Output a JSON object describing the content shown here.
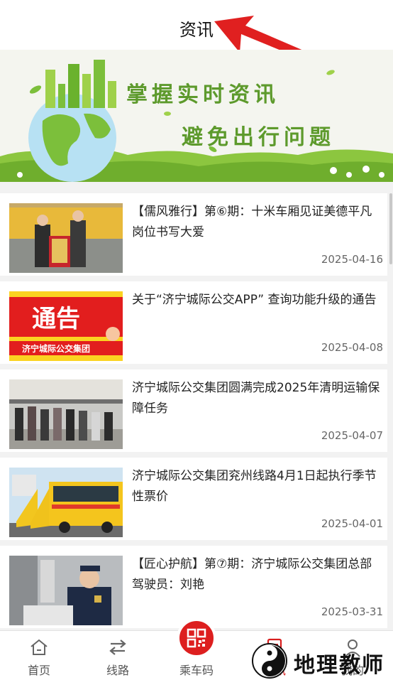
{
  "header": {
    "title": "资讯"
  },
  "banner": {
    "line1": "掌握实时资讯",
    "line2": "避免出行问题"
  },
  "news": [
    {
      "title": "【儒风雅行】第⑥期：十米车厢见证美德平凡岗位书写大爱",
      "date": "2025-04-16",
      "thumb": "photo-staff-with-banner"
    },
    {
      "title": "关于“济宁城际公交APP” 查询功能升级的通告",
      "date": "2025-04-08",
      "thumb": "notice-graphic",
      "thumb_text": "通告",
      "thumb_sub": "济宁城际公交集团"
    },
    {
      "title": "济宁城际公交集团圆满完成2025年清明运输保障任务",
      "date": "2025-04-07",
      "thumb": "photo-station-passengers"
    },
    {
      "title": "济宁城际公交集团兖州线路4月1日起执行季节性票价",
      "date": "2025-04-01",
      "thumb": "photo-yellow-buses"
    },
    {
      "title": "【匠心护航】第⑦期：济宁城际公交集团总部驾驶员：刘艳",
      "date": "2025-03-31",
      "thumb": "photo-driver"
    }
  ],
  "tabbar": {
    "items": [
      {
        "label": "首页",
        "icon": "home-icon"
      },
      {
        "label": "线路",
        "icon": "route-switch-icon"
      },
      {
        "label": "乘车码",
        "icon": "qr-code-icon"
      },
      {
        "label": "资讯",
        "icon": "news-document-icon"
      },
      {
        "label": "我的",
        "icon": "user-icon"
      }
    ],
    "active": "资讯"
  },
  "watermark": {
    "text": "地理教师"
  },
  "colors": {
    "accent": "#d81e1e",
    "banner_green": "#5d9a2c",
    "background": "#f2f2f2"
  }
}
